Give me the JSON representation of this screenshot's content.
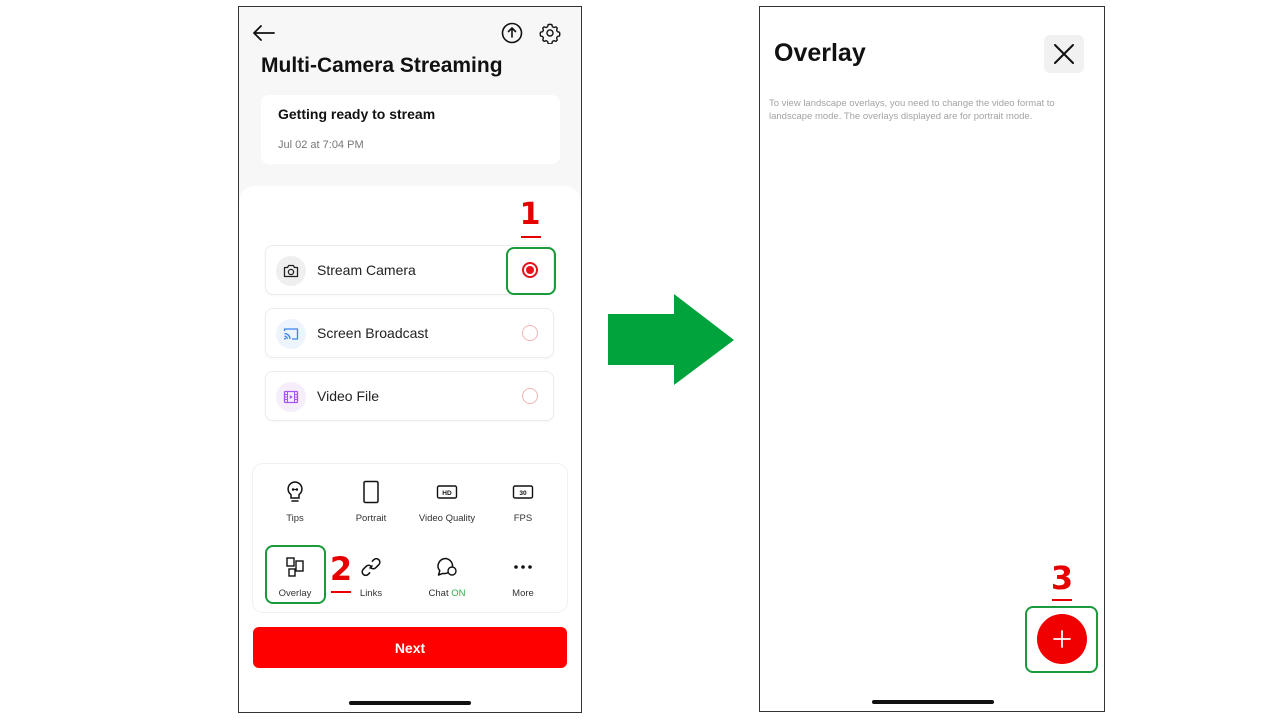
{
  "left_screen": {
    "title": "Multi-Camera Streaming",
    "status_card": {
      "title": "Getting ready to stream",
      "time": "Jul 02 at 7:04 PM"
    },
    "sources": [
      {
        "label": "Stream Camera",
        "icon": "camera-icon",
        "selected": true
      },
      {
        "label": "Screen Broadcast",
        "icon": "cast-icon",
        "selected": false
      },
      {
        "label": "Video File",
        "icon": "film-icon",
        "selected": false
      }
    ],
    "tools": [
      {
        "label": "Tips",
        "icon": "lightbulb-icon"
      },
      {
        "label": "Portrait",
        "icon": "portrait-icon"
      },
      {
        "label": "Video Quality",
        "icon": "hd-icon",
        "badge": "HD"
      },
      {
        "label": "FPS",
        "icon": "fps-icon",
        "badge": "30"
      },
      {
        "label": "Overlay",
        "icon": "overlay-icon"
      },
      {
        "label": "Links",
        "icon": "link-icon"
      },
      {
        "label": "Chat",
        "status": "ON",
        "icon": "chat-icon"
      },
      {
        "label": "More",
        "icon": "more-icon"
      }
    ],
    "next_label": "Next"
  },
  "right_screen": {
    "title": "Overlay",
    "note": "To view landscape overlays, you need to change the video format to landscape mode. The overlays displayed are for portrait mode."
  },
  "steps": {
    "step1": "1",
    "step2": "2",
    "step3": "3"
  },
  "colors": {
    "accent": "#FF0000",
    "highlight": "#1A9A3A",
    "arrow": "#00A33C",
    "chat_on": "#28B446"
  }
}
